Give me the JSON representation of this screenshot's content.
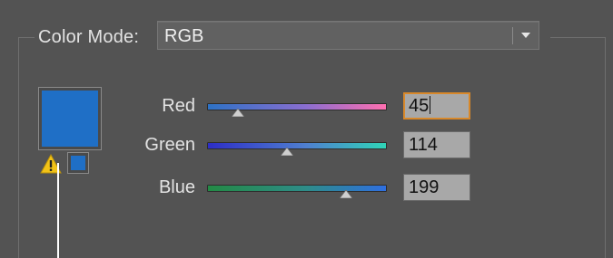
{
  "color_mode": {
    "label": "Color Mode:",
    "selected": "RGB"
  },
  "swatch": {
    "color": "#1f6fc6",
    "gamut_color": "#1f6fc6",
    "warning_icon": "warning-triangle-icon"
  },
  "sliders": [
    {
      "label": "Red",
      "value": "45",
      "fraction": 0.176,
      "gradient": "linear-gradient(to right, #2d72c6, #8a6ed0 55%, #ff6fb0)"
    },
    {
      "label": "Green",
      "value": "114",
      "fraction": 0.447,
      "gradient": "linear-gradient(to right, #2d2ec7, #4f7fd0 55%, #2fd4b7)"
    },
    {
      "label": "Blue",
      "value": "199",
      "fraction": 0.78,
      "gradient": "linear-gradient(to right, #238a45, #2e8c88 55%, #2f6fe0)"
    }
  ],
  "colors": {
    "focus_border": "#d8882a",
    "panel_bg": "#535353",
    "field_bg": "#a8a8a8"
  }
}
